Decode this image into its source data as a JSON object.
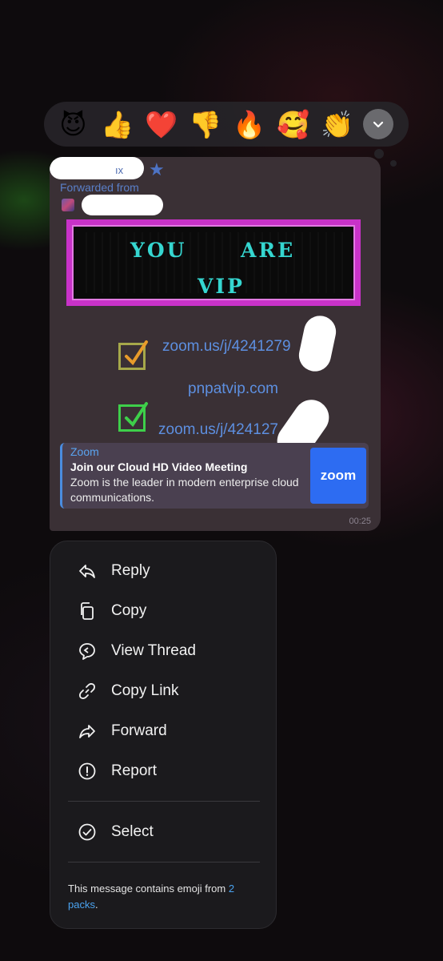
{
  "reactions": [
    {
      "emoji": "😈",
      "name": "smiling-devil"
    },
    {
      "emoji": "👍",
      "name": "thumbs-up"
    },
    {
      "emoji": "❤️",
      "name": "red-heart"
    },
    {
      "emoji": "👎",
      "name": "thumbs-down"
    },
    {
      "emoji": "🔥",
      "name": "fire"
    },
    {
      "emoji": "🥰",
      "name": "smiling-hearts"
    },
    {
      "emoji": "👏",
      "name": "clapping-hands"
    }
  ],
  "message": {
    "sender_visible": "ıx",
    "forwarded_label": "Forwarded from",
    "banner": {
      "line1_a": "YOU",
      "line1_b": "ARE",
      "line2": "VIP"
    },
    "links": [
      "zoom.us/j/4241279",
      "pnpatvip.com",
      "zoom.us/j/424127"
    ],
    "link_preview": {
      "site": "Zoom",
      "title": "Join our Cloud HD Video Meeting",
      "description": "Zoom is the leader in modern enterprise cloud communications.",
      "logo_text": "zoom"
    },
    "time": "00:25"
  },
  "menu": {
    "items": [
      {
        "label": "Reply",
        "icon": "reply-icon"
      },
      {
        "label": "Copy",
        "icon": "copy-icon"
      },
      {
        "label": "View Thread",
        "icon": "thread-icon"
      },
      {
        "label": "Copy Link",
        "icon": "link-icon"
      },
      {
        "label": "Forward",
        "icon": "forward-icon"
      },
      {
        "label": "Report",
        "icon": "report-icon"
      }
    ],
    "select_label": "Select",
    "emoji_note_text": "This message contains emoji from ",
    "emoji_note_link": "2 packs",
    "emoji_note_end": "."
  },
  "colors": {
    "accent": "#4aa3f0",
    "link": "#5d8fe0",
    "banner_border": "#c832c8",
    "banner_text": "#35d6d0"
  }
}
